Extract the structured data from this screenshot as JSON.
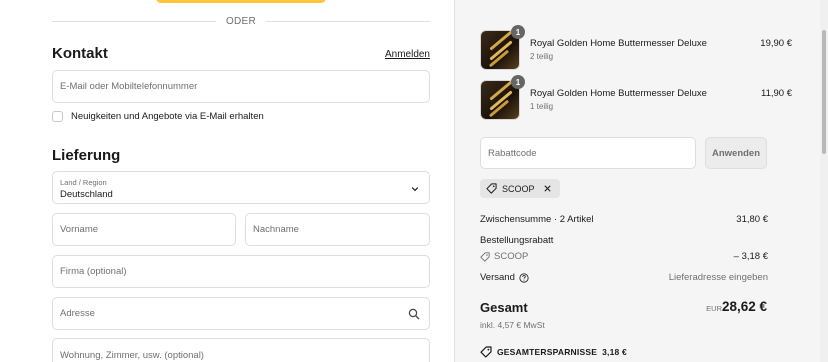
{
  "divider_text": "ODER",
  "contact": {
    "heading": "Kontakt",
    "login_link": "Anmelden",
    "email_placeholder": "E-Mail oder Mobiltelefonnummer",
    "newsletter_label": "Neuigkeiten und Angebote via E-Mail erhalten"
  },
  "delivery": {
    "heading": "Lieferung",
    "country_label": "Land / Region",
    "country_value": "Deutschland",
    "first_name_placeholder": "Vorname",
    "last_name_placeholder": "Nachname",
    "company_placeholder": "Firma (optional)",
    "address_placeholder": "Adresse",
    "apartment_placeholder": "Wohnung, Zimmer, usw. (optional)"
  },
  "cart": {
    "items": [
      {
        "name": "Royal Golden Home Buttermesser Deluxe",
        "variant": "2 teilig",
        "price": "19,90 €",
        "quantity": "1"
      },
      {
        "name": "Royal Golden Home Buttermesser Deluxe",
        "variant": "1 teilig",
        "price": "11,90 €",
        "quantity": "1"
      }
    ],
    "discount_placeholder": "Rabattcode",
    "apply_label": "Anwenden",
    "applied_code": "SCOOP",
    "subtotal_label": "Zwischensumme · 2 Artikel",
    "subtotal_value": "31,80 €",
    "order_discount_label": "Bestellungsrabatt",
    "discount_code": "SCOOP",
    "discount_value": "– 3,18 €",
    "shipping_label": "Versand",
    "shipping_value": "Lieferadresse eingeben",
    "total_label": "Gesamt",
    "currency": "EUR",
    "total_value": "28,62 €",
    "tax_note": "inkl. 4,57 € MwSt",
    "savings_label": "GESAMTERSPARNISSE",
    "savings_value": "3,18 €"
  },
  "colors": {
    "paypal_button": "#ffc439",
    "summary_background": "#f5f5f5"
  }
}
